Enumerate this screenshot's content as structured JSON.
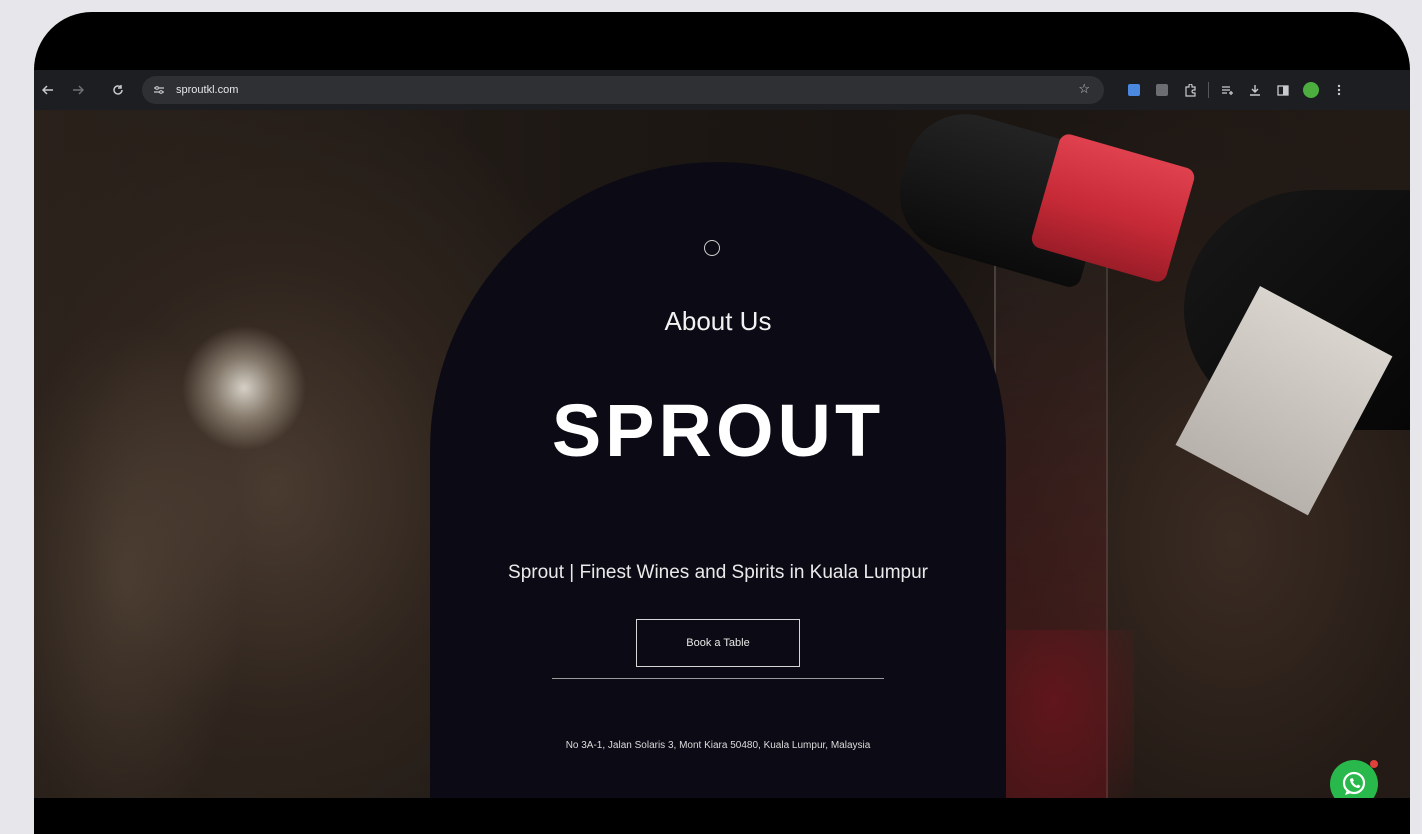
{
  "browser": {
    "url": "sproutkl.com",
    "back_icon": "back-arrow-icon",
    "forward_icon": "forward-arrow-icon",
    "reload_icon": "reload-icon"
  },
  "hero": {
    "about": "About Us",
    "brand": "SPROUT",
    "tagline": "Sprout | Finest Wines and Spirits in Kuala Lumpur",
    "button": "Book a Table",
    "address": "No 3A-1, Jalan Solaris 3, Mont Kiara 50480, Kuala Lumpur, Malaysia"
  },
  "colors": {
    "arch": "#0c0a14",
    "whatsapp": "#29b84b",
    "foil": "#c72a37",
    "frame": "#000000",
    "background": "#e7e6ea"
  },
  "icons": {
    "whatsapp": "whatsapp-icon"
  }
}
